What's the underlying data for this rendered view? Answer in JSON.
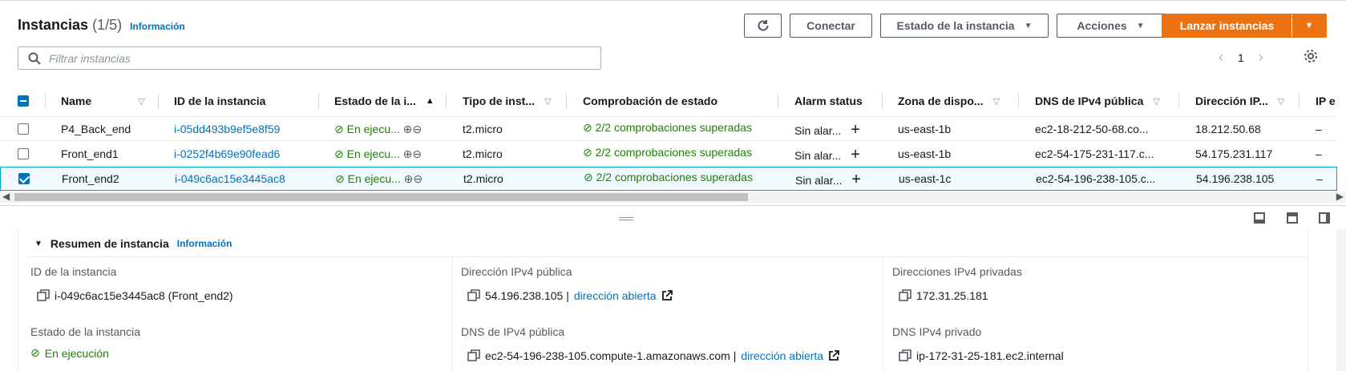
{
  "header": {
    "title": "Instancias",
    "count": "(1/5)",
    "info": "Información",
    "connect": "Conectar",
    "instance_state": "Estado de la instancia",
    "actions": "Acciones",
    "launch": "Lanzar instancias"
  },
  "filter": {
    "placeholder": "Filtrar instancias"
  },
  "pagination": {
    "page": "1"
  },
  "columns": {
    "name": "Name",
    "id": "ID de la instancia",
    "state": "Estado de la i...",
    "type": "Tipo de inst...",
    "check": "Comprobación de estado",
    "alarm": "Alarm status",
    "zone": "Zona de dispo...",
    "dns": "DNS de IPv4 pública",
    "ip": "Dirección IP...",
    "ipe": "IP e"
  },
  "rows": [
    {
      "name": "P4_Back_end",
      "id": "i-05dd493b9ef5e8f59",
      "state": "En ejecu...",
      "type": "t2.micro",
      "check": "2/2 comprobaciones superadas",
      "alarm": "Sin alar...",
      "zone": "us-east-1b",
      "dns": "ec2-18-212-50-68.co...",
      "ip": "18.212.50.68",
      "ipe": "–",
      "selected": false
    },
    {
      "name": "Front_end1",
      "id": "i-0252f4b69e90fead6",
      "state": "En ejecu...",
      "type": "t2.micro",
      "check": "2/2 comprobaciones superadas",
      "alarm": "Sin alar...",
      "zone": "us-east-1b",
      "dns": "ec2-54-175-231-117.c...",
      "ip": "54.175.231.117",
      "ipe": "–",
      "selected": false
    },
    {
      "name": "Front_end2",
      "id": "i-049c6ac15e3445ac8",
      "state": "En ejecu...",
      "type": "t2.micro",
      "check": "2/2 comprobaciones superadas",
      "alarm": "Sin alar...",
      "zone": "us-east-1c",
      "dns": "ec2-54-196-238-105.c...",
      "ip": "54.196.238.105",
      "ipe": "–",
      "selected": true
    }
  ],
  "summary": {
    "title": "Resumen de instancia",
    "info": "Información",
    "id_label": "ID de la instancia",
    "id_value": "i-049c6ac15e3445ac8 (Front_end2)",
    "state_label": "Estado de la instancia",
    "state_value": "En ejecución",
    "public_ip_label": "Dirección IPv4 pública",
    "public_ip_value": "54.196.238.105 |",
    "open_address": "dirección abierta",
    "public_dns_label": "DNS de IPv4 pública",
    "public_dns_value": "ec2-54-196-238-105.compute-1.amazonaws.com |",
    "private_ip_label": "Direcciones IPv4 privadas",
    "private_ip_value": "172.31.25.181",
    "private_dns_label": "DNS IPv4 privado",
    "private_dns_value": "ip-172-31-25-181.ec2.internal"
  },
  "colors": {
    "accent": "#ec7211",
    "link": "#0073bb",
    "success": "#1d8102"
  }
}
